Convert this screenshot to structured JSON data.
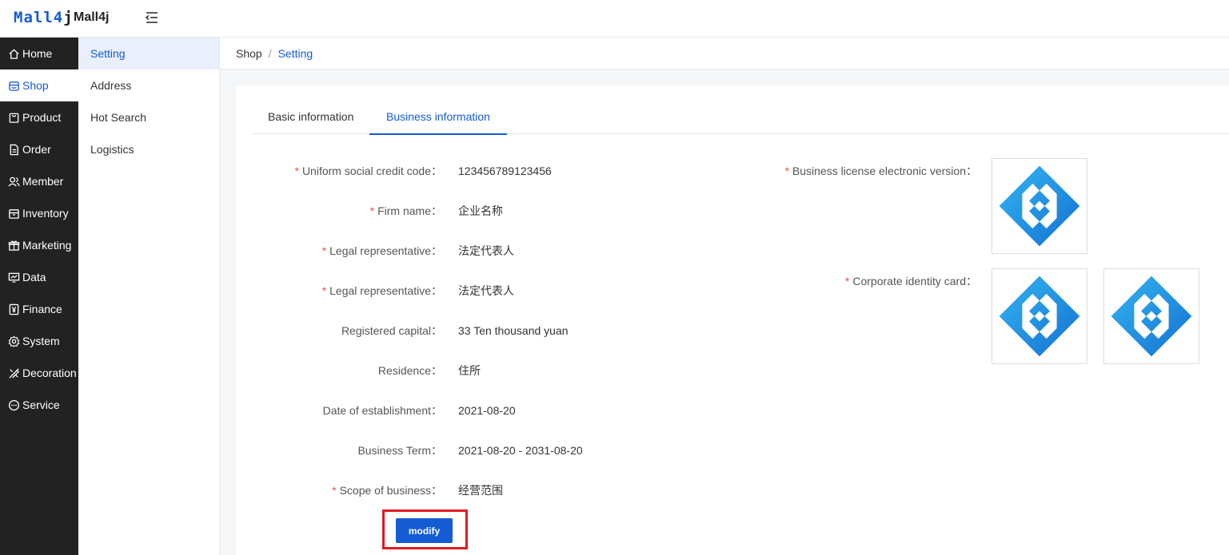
{
  "header": {
    "logo_main": "Mall4",
    "logo_j": "j",
    "app_name": "Mall4j"
  },
  "sidebar": {
    "items": [
      {
        "label": "Home",
        "icon": "house-icon"
      },
      {
        "label": "Shop",
        "icon": "storefront-icon",
        "active": true
      },
      {
        "label": "Product",
        "icon": "bag-icon"
      },
      {
        "label": "Order",
        "icon": "document-icon"
      },
      {
        "label": "Member",
        "icon": "users-icon"
      },
      {
        "label": "Inventory",
        "icon": "box-icon"
      },
      {
        "label": "Marketing",
        "icon": "gift-icon"
      },
      {
        "label": "Data",
        "icon": "chart-screen-icon"
      },
      {
        "label": "Finance",
        "icon": "yen-icon"
      },
      {
        "label": "System",
        "icon": "gear-icon"
      },
      {
        "label": "Decoration",
        "icon": "brush-icon"
      },
      {
        "label": "Service",
        "icon": "chat-icon"
      }
    ]
  },
  "subnav": {
    "items": [
      "Setting",
      "Address",
      "Hot Search",
      "Logistics"
    ]
  },
  "breadcrumb": {
    "parent": "Shop",
    "separator": "/",
    "current": "Setting"
  },
  "tabs": [
    "Basic information",
    "Business information"
  ],
  "form": {
    "fields": [
      {
        "label": "Uniform social credit code：",
        "value": "123456789123456",
        "required": true
      },
      {
        "label": "Firm name：",
        "value": "企业名称",
        "required": true
      },
      {
        "label": "Legal representative：",
        "value": "法定代表人",
        "required": true
      },
      {
        "label": "Legal representative：",
        "value": "法定代表人",
        "required": true
      },
      {
        "label": "Registered capital：",
        "value": "33 Ten thousand yuan",
        "required": false
      },
      {
        "label": "Residence：",
        "value": "住所",
        "required": false
      },
      {
        "label": "Date of establishment：",
        "value": "2021-08-20",
        "required": false
      },
      {
        "label": "Business Term：",
        "value": "2021-08-20 - 2031-08-20",
        "required": false
      },
      {
        "label": "Scope of business：",
        "value": "经营范围",
        "required": true
      }
    ],
    "required_mark": "*",
    "license_label": "Business license electronic version：",
    "id_card_label": "Corporate identity card：",
    "modify_label": "modify"
  },
  "colors": {
    "brand": "#155bd4",
    "sidebar_bg": "#222222",
    "required": "#f04d4d",
    "highlight": "#e11b22",
    "logo_blue": "#1a9ee8"
  }
}
